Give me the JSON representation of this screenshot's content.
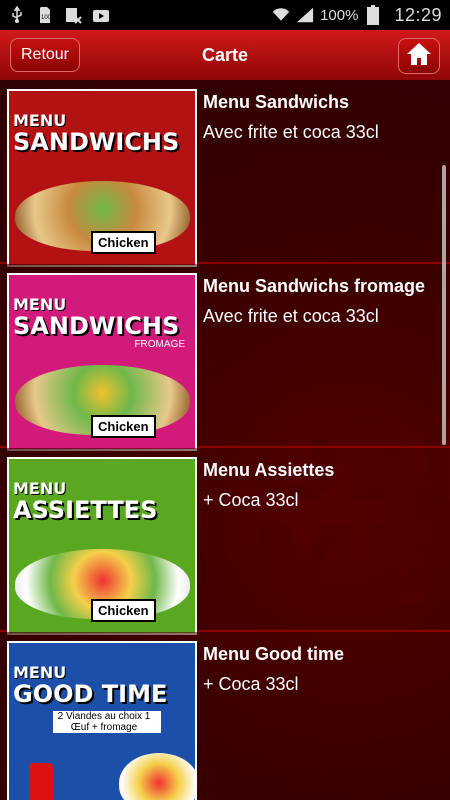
{
  "status": {
    "battery_percent": "100%",
    "time": "12:29"
  },
  "header": {
    "back_label": "Retour",
    "title": "Carte"
  },
  "background_text": "ODE\nME",
  "items": [
    {
      "title": "Menu Sandwichs",
      "subtitle": "Avec frite et coca 33cl",
      "thumb_line1": "MENU",
      "thumb_line2": "SANDWICHS",
      "thumb_line3": "",
      "tag": "Chicken",
      "thumb_bg": "#b21212"
    },
    {
      "title": "Menu Sandwichs fromage",
      "subtitle": "Avec frite et coca 33cl",
      "thumb_line1": "MENU",
      "thumb_line2": "SANDWICHS",
      "thumb_line3": "FROMAGE",
      "tag": "Chicken",
      "thumb_bg": "#d11a7a"
    },
    {
      "title": "Menu Assiettes",
      "subtitle": "+ Coca 33cl",
      "thumb_line1": "MENU",
      "thumb_line2": "ASSIETTES",
      "thumb_line3": "",
      "tag": "Chicken",
      "thumb_bg": "#5aa821"
    },
    {
      "title": "Menu Good time",
      "subtitle": "+ Coca 33cl",
      "thumb_line1": "MENU",
      "thumb_line2": "GOOD TIME",
      "thumb_line3": "2 Viandes au choix 1 Œuf + fromage",
      "tag": "",
      "thumb_bg": "#1c4fa8"
    }
  ]
}
